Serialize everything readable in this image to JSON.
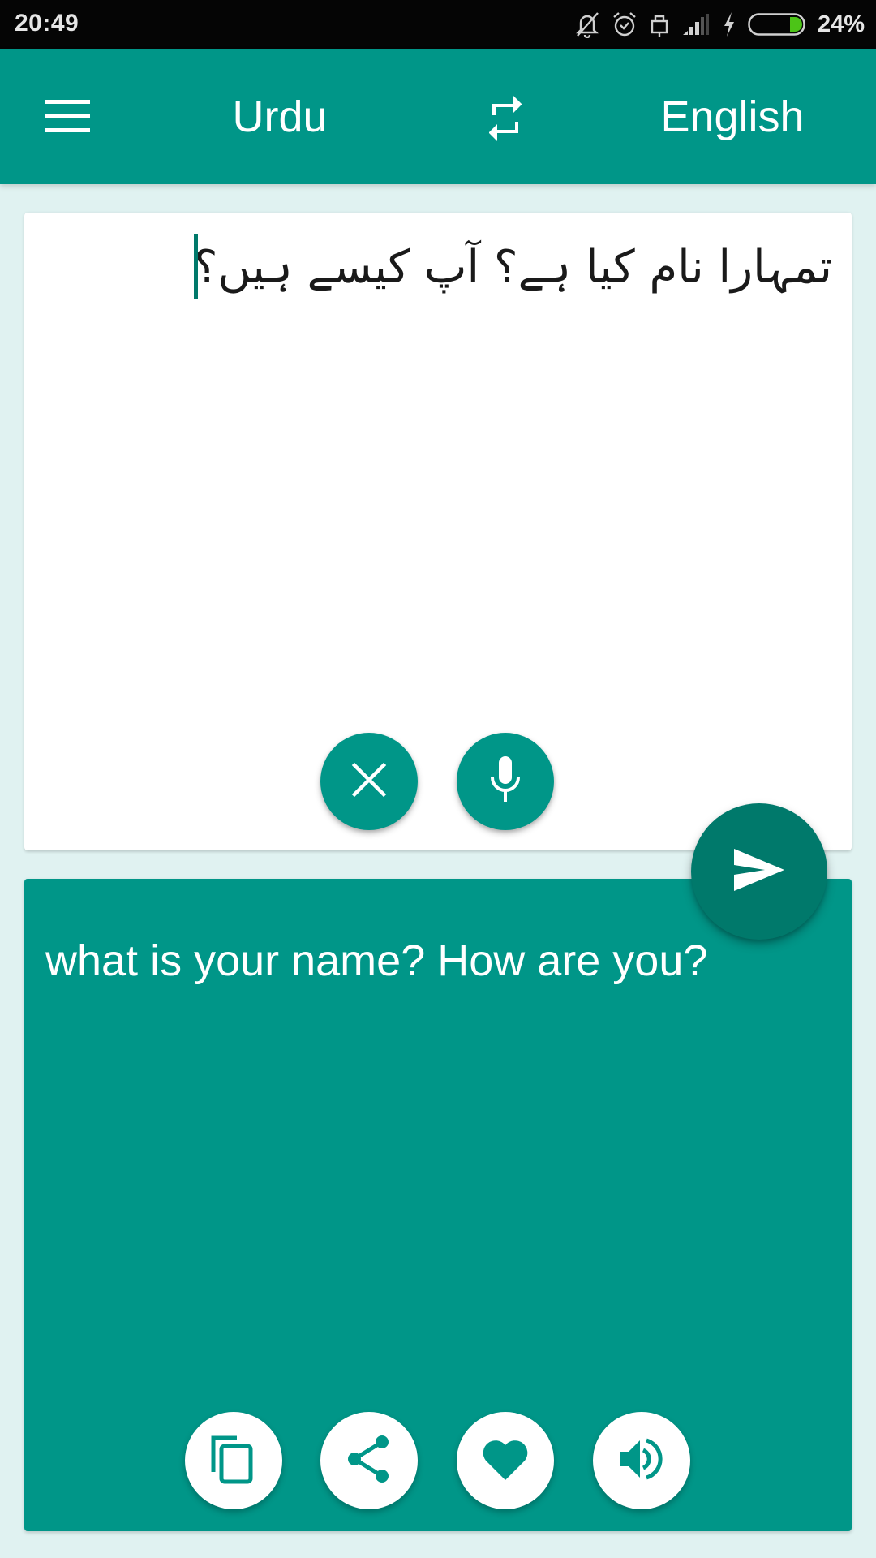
{
  "status_bar": {
    "time": "20:49",
    "battery_percent": "24%",
    "battery_level": 0.24,
    "icons": [
      "notifications-off-icon",
      "alarm-icon",
      "lock-icon",
      "signal-icon",
      "charging-icon",
      "battery-icon"
    ]
  },
  "app_bar": {
    "menu_icon": "menu-icon",
    "source_language": "Urdu",
    "swap_icon": "swap-languages-icon",
    "target_language": "English"
  },
  "input": {
    "text": "تمہارا نام کیا ہے؟ آپ کیسے ہیں؟",
    "direction": "rtl",
    "clear_icon": "close-icon",
    "mic_icon": "microphone-icon"
  },
  "send": {
    "icon": "send-icon"
  },
  "output": {
    "text": "what is your name? How are you?",
    "actions": [
      {
        "name": "copy",
        "icon": "copy-icon"
      },
      {
        "name": "share",
        "icon": "share-icon"
      },
      {
        "name": "favorite",
        "icon": "heart-icon"
      },
      {
        "name": "speak",
        "icon": "speaker-icon"
      }
    ]
  },
  "colors": {
    "primary": "#009688",
    "primary_dark": "#00796B",
    "background": "#E0F2F1",
    "card": "#FFFFFF",
    "battery_fill": "#4CC417"
  }
}
